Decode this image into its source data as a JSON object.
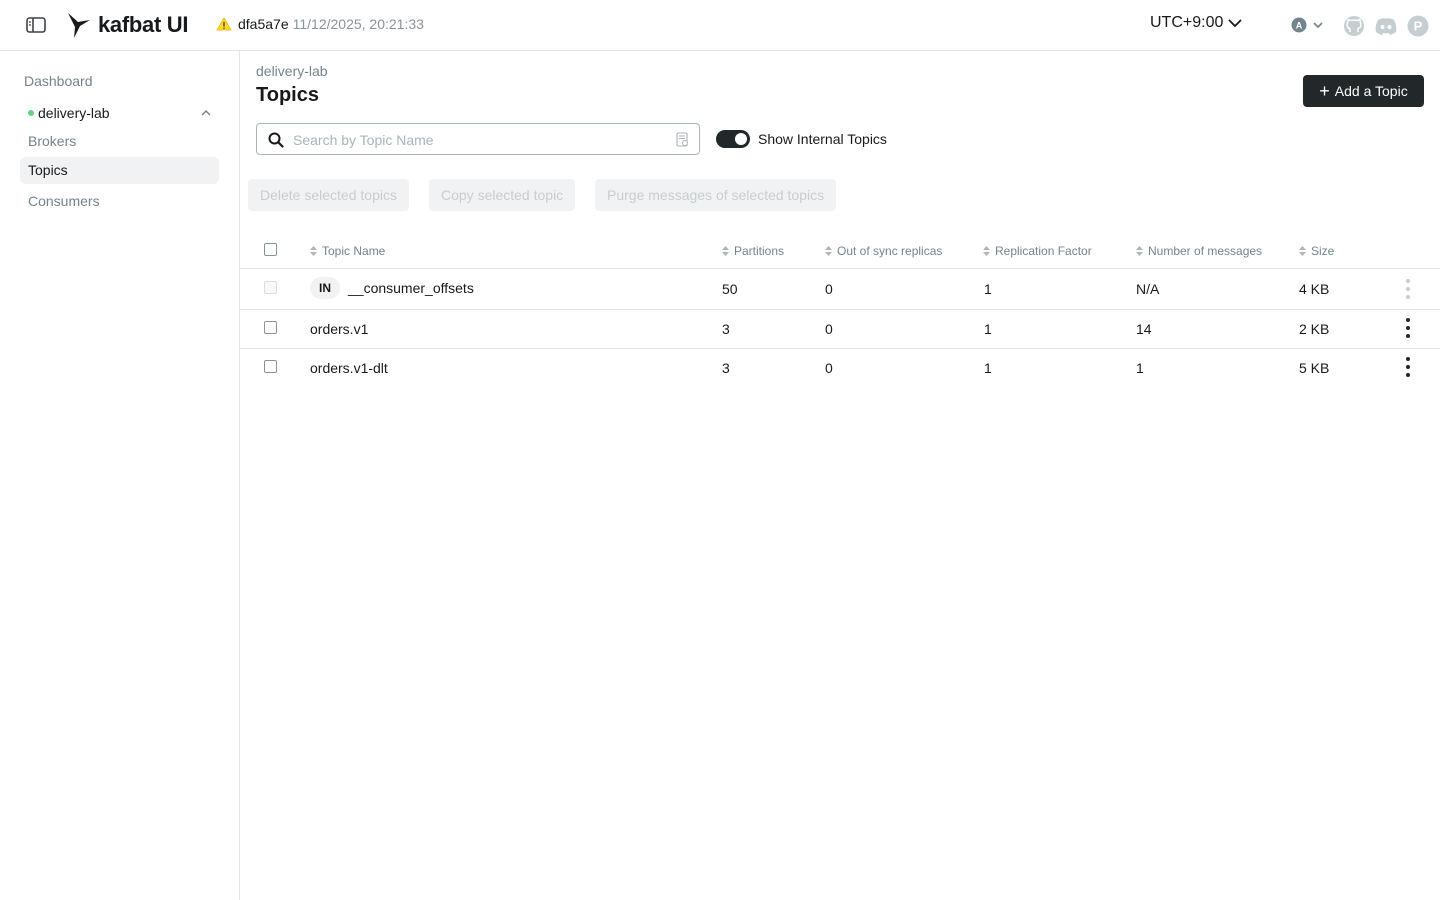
{
  "app": {
    "logo_text": "kafbat UI",
    "version_hash": "dfa5a7e",
    "build_date": "11/12/2025, 20:21:33",
    "timezone": "UTC+9:00",
    "user_initial": "A",
    "discord_initial": "P"
  },
  "sidebar": {
    "dashboard": "Dashboard",
    "cluster": "delivery-lab",
    "items": [
      {
        "label": "Brokers",
        "active": false
      },
      {
        "label": "Topics",
        "active": true
      },
      {
        "label": "Consumers",
        "active": false
      }
    ]
  },
  "main": {
    "breadcrumb": "delivery-lab",
    "title": "Topics",
    "add_button": "Add a Topic",
    "search_placeholder": "Search by Topic Name",
    "toggle_label": "Show Internal Topics",
    "bulk_actions": [
      "Delete selected topics",
      "Copy selected topic",
      "Purge messages of selected topics"
    ]
  },
  "table": {
    "columns": [
      "Topic Name",
      "Partitions",
      "Out of sync replicas",
      "Replication Factor",
      "Number of messages",
      "Size"
    ],
    "rows": [
      {
        "internal_badge": "IN",
        "name": "__consumer_offsets",
        "partitions": "50",
        "out_of_sync": "0",
        "replication": "1",
        "messages": "N/A",
        "size": "4 KB"
      },
      {
        "internal_badge": "",
        "name": "orders.v1",
        "partitions": "3",
        "out_of_sync": "0",
        "replication": "1",
        "messages": "14",
        "size": "2 KB"
      },
      {
        "internal_badge": "",
        "name": "orders.v1-dlt",
        "partitions": "3",
        "out_of_sync": "0",
        "replication": "1",
        "messages": "1",
        "size": "5 KB"
      }
    ]
  },
  "colors": {
    "primary_button": "#22282a",
    "cluster_online": "#5cd685",
    "warning": "#fdd835"
  }
}
